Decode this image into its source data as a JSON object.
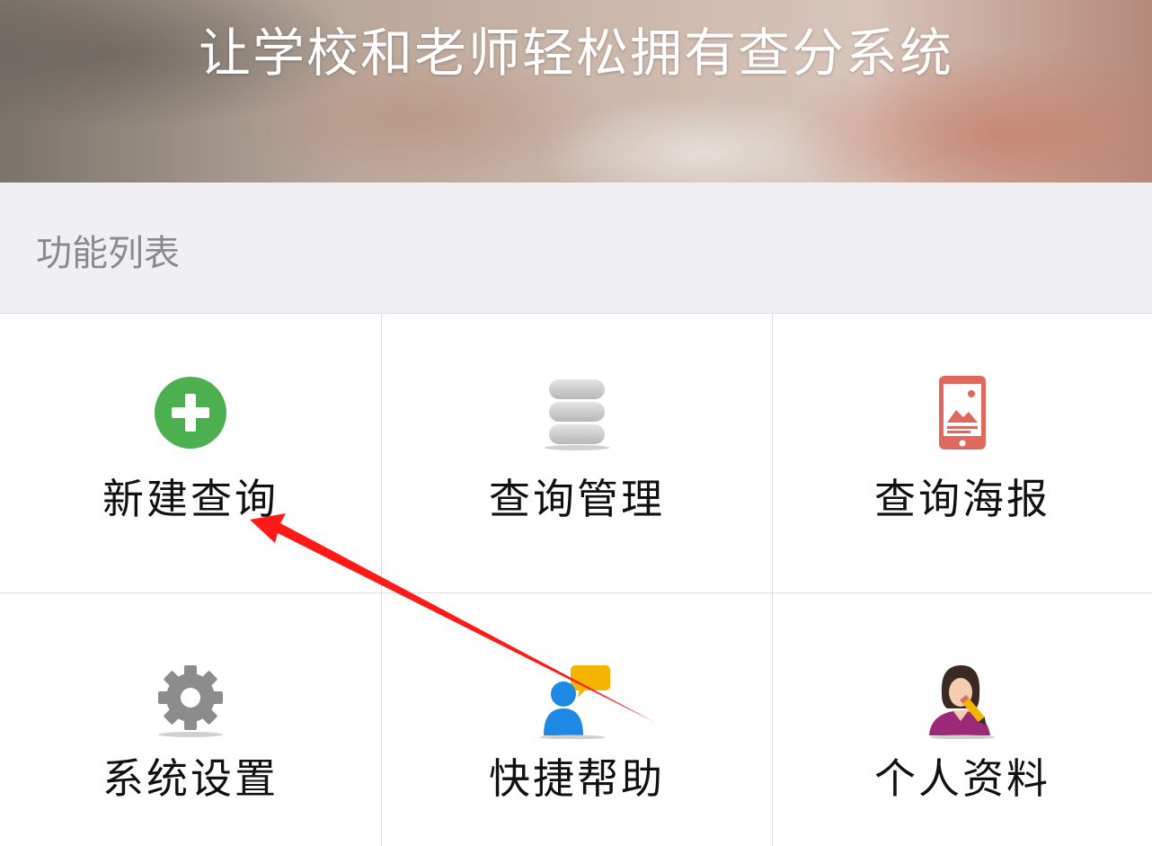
{
  "banner": {
    "title": "让学校和老师轻松拥有查分系统"
  },
  "section": {
    "title": "功能列表"
  },
  "menu": {
    "items": [
      {
        "label": "新建查询",
        "icon": "plus-circle-icon",
        "color": "#4caf50"
      },
      {
        "label": "查询管理",
        "icon": "database-icon",
        "color": "#c7c7c7"
      },
      {
        "label": "查询海报",
        "icon": "phone-poster-icon",
        "color": "#e0695f"
      },
      {
        "label": "系统设置",
        "icon": "gear-icon",
        "color": "#8c8c8c"
      },
      {
        "label": "快捷帮助",
        "icon": "help-chat-icon",
        "color": "#1e88e5"
      },
      {
        "label": "个人资料",
        "icon": "profile-icon",
        "color": "#9c2a78"
      }
    ]
  },
  "annotation": {
    "arrow_color": "#ff1a1a"
  }
}
